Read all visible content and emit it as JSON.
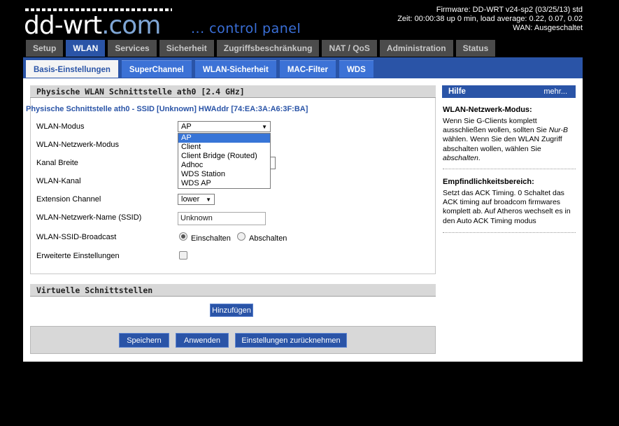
{
  "header": {
    "logo_text": "dd-wrt",
    "logo_suffix": ".com",
    "tagline": "... control panel",
    "firmware": "Firmware: DD-WRT v24-sp2 (03/25/13) std",
    "uptime": "Zeit: 00:00:38 up 0 min, load average: 0.22, 0.07, 0.02",
    "wan": "WAN: Ausgeschaltet"
  },
  "main_tabs": [
    {
      "label": "Setup",
      "active": false
    },
    {
      "label": "WLAN",
      "active": true
    },
    {
      "label": "Services",
      "active": false
    },
    {
      "label": "Sicherheit",
      "active": false
    },
    {
      "label": "Zugriffsbeschränkung",
      "active": false
    },
    {
      "label": "NAT / QoS",
      "active": false
    },
    {
      "label": "Administration",
      "active": false
    },
    {
      "label": "Status",
      "active": false
    }
  ],
  "sub_tabs": [
    {
      "label": "Basis-Einstellungen",
      "active": true
    },
    {
      "label": "SuperChannel",
      "active": false
    },
    {
      "label": "WLAN-Sicherheit",
      "active": false
    },
    {
      "label": "MAC-Filter",
      "active": false
    },
    {
      "label": "WDS",
      "active": false
    }
  ],
  "section1": {
    "title": "Physische WLAN Schnittstelle ath0 [2.4 GHz]",
    "legend": "Physische Schnittstelle ath0 - SSID [Unknown] HWAddr [74:EA:3A:A6:3F:BA]",
    "fields": {
      "wlan_mode": "WLAN-Modus",
      "net_mode": "WLAN-Netzwerk-Modus",
      "channel_width": "Kanal Breite",
      "channel": "WLAN-Kanal",
      "ext_channel": "Extension Channel",
      "ssid": "WLAN-Netzwerk-Name (SSID)",
      "broadcast": "WLAN-SSID-Broadcast",
      "advanced": "Erweiterte Einstellungen"
    },
    "wlan_mode_value": "AP",
    "wlan_mode_options": [
      "AP",
      "Client",
      "Client Bridge (Routed)",
      "Adhoc",
      "WDS Station",
      "WDS AP"
    ],
    "ext_channel_value": "lower",
    "ssid_value": "Unknown",
    "broadcast_on": "Einschalten",
    "broadcast_off": "Abschalten"
  },
  "section2": {
    "title": "Virtuelle Schnittstellen",
    "add_button": "Hinzufügen"
  },
  "buttons": {
    "save": "Speichern",
    "apply": "Anwenden",
    "reset": "Einstellungen zurücknehmen"
  },
  "help": {
    "title": "Hilfe",
    "more": "mehr...",
    "h1": "WLAN-Netzwerk-Modus:",
    "t1a": "Wenn Sie G-Clients komplett ausschließen wollen, sollten Sie ",
    "t1b": "Nur-B",
    "t1c": " wählen. Wenn Sie den WLAN Zugriff abschalten wollen, wählen Sie ",
    "t1d": "abschalten",
    "t1e": ".",
    "h2": "Empfindlichkeitsbereich:",
    "t2": "Setzt das ACK Timing. 0 Schaltet das ACK timing auf broadcom firmwares komplett ab. Auf Atheros wechselt es in den Auto ACK Timing modus"
  },
  "colors": {
    "accent": "#2a54a7",
    "tab_inactive": "#4b4b4b",
    "section_bg": "#d8d8d8",
    "select_highlight": "#3875d7"
  }
}
